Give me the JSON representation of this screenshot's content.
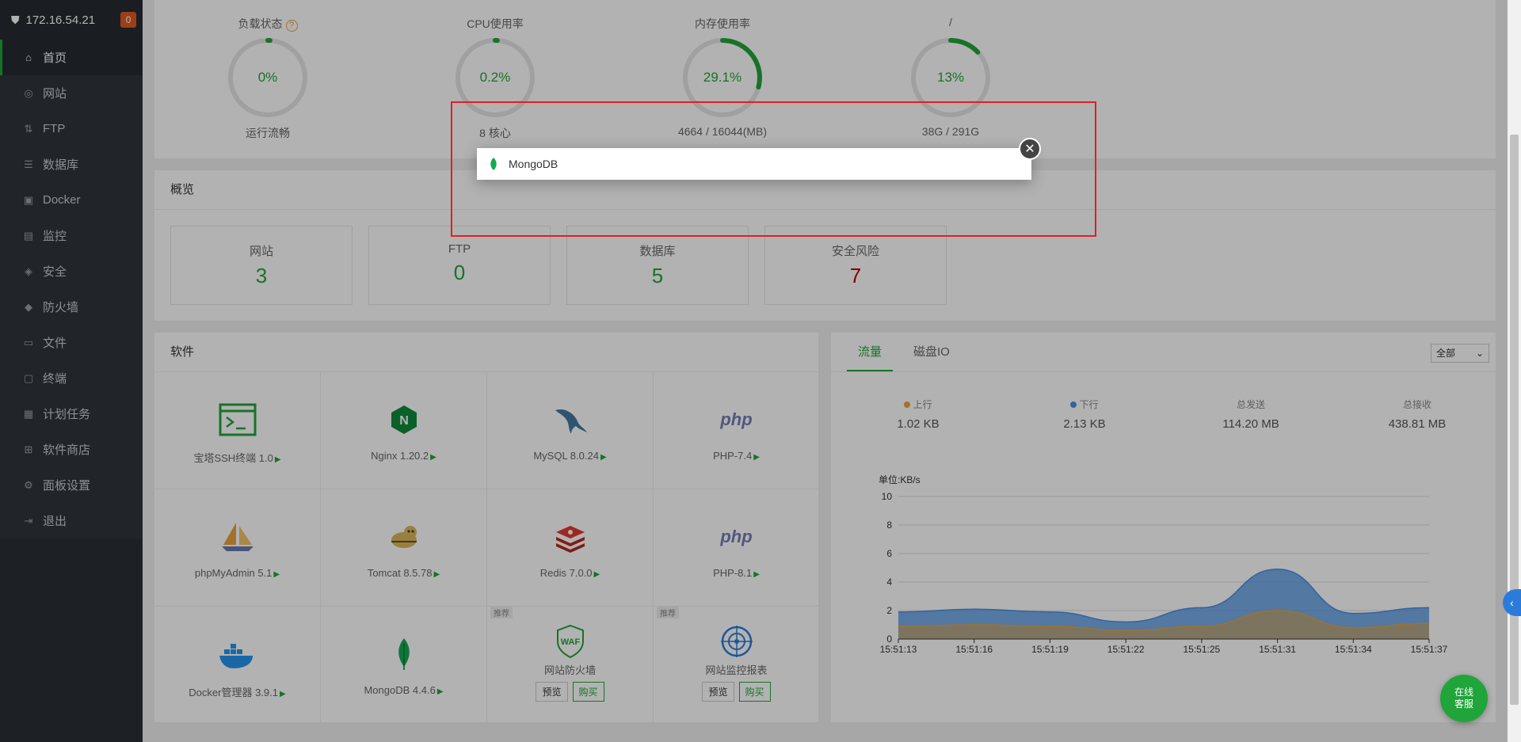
{
  "sidebar": {
    "ip": "172.16.54.21",
    "badge": "0",
    "items": [
      {
        "label": "首页"
      },
      {
        "label": "网站"
      },
      {
        "label": "FTP"
      },
      {
        "label": "数据库"
      },
      {
        "label": "Docker"
      },
      {
        "label": "监控"
      },
      {
        "label": "安全"
      },
      {
        "label": "防火墙"
      },
      {
        "label": "文件"
      },
      {
        "label": "终端"
      },
      {
        "label": "计划任务"
      },
      {
        "label": "软件商店"
      },
      {
        "label": "面板设置"
      },
      {
        "label": "退出"
      }
    ]
  },
  "status": {
    "gauges": [
      {
        "title": "负载状态",
        "value": "0%",
        "sub": "运行流畅",
        "help": "?",
        "fraction": 0.01
      },
      {
        "title": "CPU使用率",
        "value": "0.2%",
        "sub": "8 核心",
        "fraction": 0.01
      },
      {
        "title": "内存使用率",
        "value": "29.1%",
        "sub": "4664 / 16044(MB)",
        "fraction": 0.291
      },
      {
        "title": "/",
        "value": "13%",
        "sub": "38G / 291G",
        "fraction": 0.13
      }
    ]
  },
  "overview": {
    "title": "概览",
    "items": [
      {
        "label": "网站",
        "value": "3"
      },
      {
        "label": "FTP",
        "value": "0"
      },
      {
        "label": "数据库",
        "value": "5"
      },
      {
        "label": "安全风险",
        "value": "7"
      }
    ],
    "risk_color": "#c00000"
  },
  "software": {
    "title": "软件",
    "items": [
      {
        "name": "宝塔SSH终端 1.0",
        "icon": "terminal-icon"
      },
      {
        "name": "Nginx 1.20.2",
        "icon": "nginx-icon"
      },
      {
        "name": "MySQL 8.0.24",
        "icon": "mysql-icon"
      },
      {
        "name": "PHP-7.4",
        "icon": "php-icon"
      },
      {
        "name": "phpMyAdmin 5.1",
        "icon": "phpmyadmin-icon"
      },
      {
        "name": "Tomcat 8.5.78",
        "icon": "tomcat-icon"
      },
      {
        "name": "Redis 7.0.0",
        "icon": "redis-icon"
      },
      {
        "name": "PHP-8.1",
        "icon": "php-icon"
      },
      {
        "name": "Docker管理器 3.9.1",
        "icon": "docker-icon"
      },
      {
        "name": "MongoDB 4.4.6",
        "icon": "mongodb-icon"
      },
      {
        "name": "网站防火墙",
        "icon": "waf-icon",
        "tag": "推荐",
        "preview": "预览",
        "buy": "购买"
      },
      {
        "name": "网站监控报表",
        "icon": "monitor-report-icon",
        "tag": "推荐",
        "preview": "预览",
        "buy": "购买"
      }
    ],
    "php_text": "php",
    "waf_text": "WAF"
  },
  "traffic": {
    "tabs": [
      "流量",
      "磁盘IO"
    ],
    "select": "全部",
    "stats": [
      {
        "label": "上行",
        "value": "1.02 KB",
        "color": "#e8a33d"
      },
      {
        "label": "下行",
        "value": "2.13 KB",
        "color": "#4a90e2"
      },
      {
        "label": "总发送",
        "value": "114.20 MB"
      },
      {
        "label": "总接收",
        "value": "438.81 MB"
      }
    ]
  },
  "chart_data": {
    "type": "area",
    "ylabel": "单位:KB/s",
    "ylim": [
      0,
      10
    ],
    "yticks": [
      "0",
      "2",
      "4",
      "6",
      "8",
      "10"
    ],
    "x": [
      "15:51:13",
      "15:51:16",
      "15:51:19",
      "15:51:22",
      "15:51:25",
      "15:51:31",
      "15:51:34",
      "15:51:37"
    ],
    "series": [
      {
        "name": "上行",
        "color": "#e8a33d",
        "values": [
          0.9,
          1.0,
          0.9,
          0.6,
          0.9,
          2.0,
          0.8,
          1.1
        ]
      },
      {
        "name": "下行",
        "color": "#4a90e2",
        "values": [
          1.9,
          2.1,
          1.9,
          1.2,
          2.2,
          4.9,
          1.8,
          2.2
        ]
      }
    ]
  },
  "popup": {
    "label": "MongoDB",
    "icon": "mongodb-leaf-icon"
  },
  "fab": {
    "line1": "在线",
    "line2": "客服"
  },
  "side_tab": "‹"
}
